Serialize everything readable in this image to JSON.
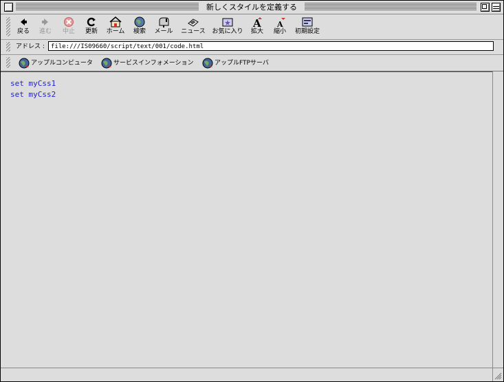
{
  "window": {
    "title": "新しくスタイルを定義する"
  },
  "toolbar": {
    "back": "戻る",
    "forward": "進む",
    "stop": "中止",
    "refresh": "更新",
    "home": "ホーム",
    "search": "検索",
    "mail": "メール",
    "news": "ニュース",
    "favorites": "お気に入り",
    "larger": "拡大",
    "smaller": "縮小",
    "preferences": "初期設定"
  },
  "address": {
    "label": "アドレス :",
    "value": "file:///IS09660/script/text/001/code.html"
  },
  "links": [
    "アップルコンピュータ",
    "サービスインフォメーション",
    "アップルFTPサーバ"
  ],
  "content": {
    "lines": [
      "set myCss1",
      "set myCss2"
    ]
  },
  "colors": {
    "link_text": "#2222cc",
    "chrome": "#dddddd"
  }
}
